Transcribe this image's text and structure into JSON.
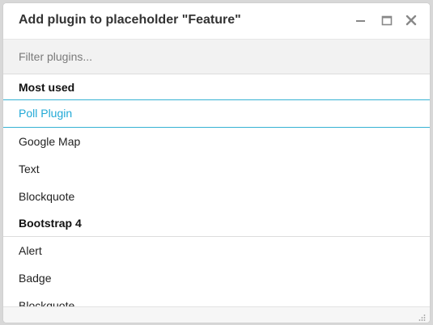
{
  "dialog": {
    "title": "Add plugin to placeholder \"Feature\"",
    "minimize_icon": "minimize-icon",
    "maximize_icon": "maximize-icon",
    "close_icon": "close-icon"
  },
  "filter": {
    "placeholder": "Filter plugins...",
    "value": ""
  },
  "sections": [
    {
      "label": "Most used",
      "items": [
        "Poll Plugin",
        "Google Map",
        "Text",
        "Blockquote"
      ]
    },
    {
      "label": "Bootstrap 4",
      "items": [
        "Alert",
        "Badge",
        "Blockquote"
      ]
    }
  ],
  "colors": {
    "active_item": "#21a9d6",
    "active_border": "#36b2d3"
  }
}
